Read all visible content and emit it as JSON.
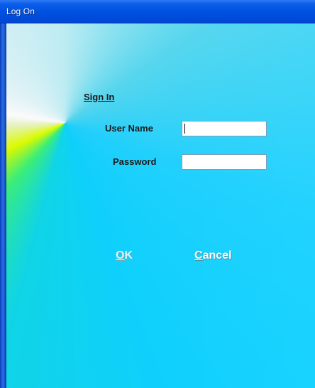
{
  "window": {
    "title": "Log On"
  },
  "form": {
    "heading": "Sign In",
    "username_label": "User Name",
    "username_value": "",
    "password_label": "Password",
    "password_value": ""
  },
  "buttons": {
    "ok_accel": "O",
    "ok_rest": "K",
    "cancel_accel": "C",
    "cancel_rest": "ancel"
  },
  "colors": {
    "titlebar": "#0050e0",
    "background_cyan": "#10d2ff",
    "background_yellow": "#dfff00"
  }
}
